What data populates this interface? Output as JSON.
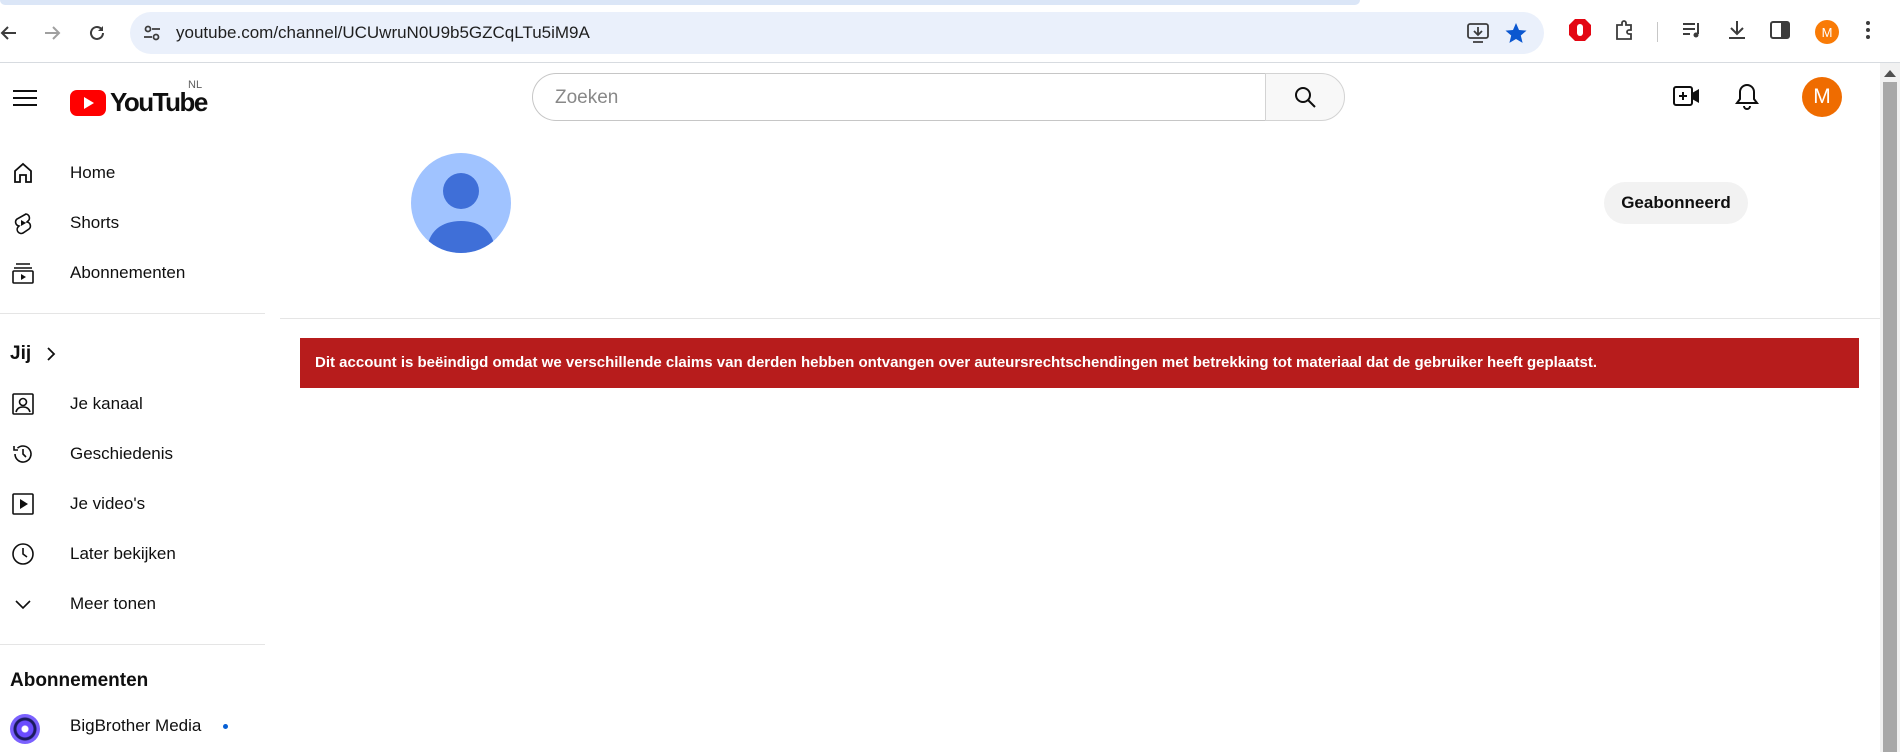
{
  "browser": {
    "url": "youtube.com/channel/UCUwruN0U9b5GZCqLTu5iM9A",
    "profile_initial": "M"
  },
  "masthead": {
    "logo_text": "YouTube",
    "country_code": "NL",
    "search_placeholder": "Zoeken",
    "avatar_initial": "M"
  },
  "sidebar": {
    "main_items": [
      {
        "label": "Home",
        "icon": "home-icon"
      },
      {
        "label": "Shorts",
        "icon": "shorts-icon"
      },
      {
        "label": "Abonnementen",
        "icon": "subscriptions-icon"
      }
    ],
    "you_heading": "Jij",
    "you_items": [
      {
        "label": "Je kanaal",
        "icon": "your-channel-icon"
      },
      {
        "label": "Geschiedenis",
        "icon": "history-icon"
      },
      {
        "label": "Je video's",
        "icon": "your-videos-icon"
      },
      {
        "label": "Later bekijken",
        "icon": "watch-later-icon"
      },
      {
        "label": "Meer tonen",
        "icon": "chevron-down-icon"
      }
    ],
    "subscriptions_heading": "Abonnementen",
    "subscriptions": [
      {
        "name": "BigBrother Media"
      }
    ]
  },
  "channel": {
    "subscribe_label": "Geabonneerd",
    "terminated_notice": "Dit account is beëindigd omdat we verschillende claims van derden hebben ontvangen over auteursrechtschendingen met betrekking tot materiaal dat de gebruiker heeft geplaatst."
  },
  "colors": {
    "alert_bg": "#b71c1c",
    "brand_red": "#ff0000",
    "avatar_orange": "#ef6c00"
  }
}
